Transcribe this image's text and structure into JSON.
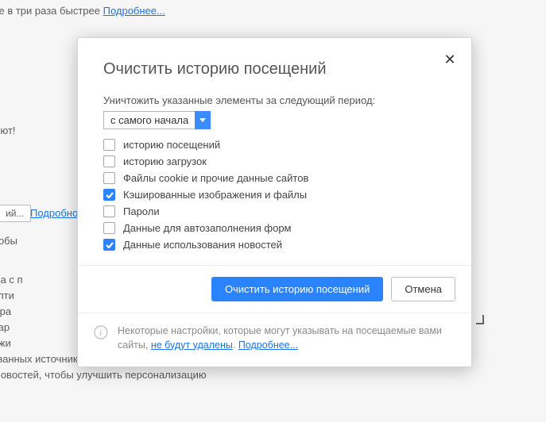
{
  "bg": {
    "top_text": "ботать в интернете в три раза быстрее",
    "top_link": "Подробнее...",
    "mid1": "та криптовалют!",
    "btn_suffix": "ий...",
    "link2": "Подробно",
    "mid2": "б-службы, чтобы",
    "p1": "росы и адреса с п",
    "p2": "йствия для опти",
    "p3": "ть Opera, отпра",
    "p4": "отчеты об авар",
    "p5": "ок «Не отслежи",
    "p6": "я рекомендованных источников в «Новостях» на основании истории посещении",
    "p7": "ользовании новостей, чтобы улучшить персонализацию"
  },
  "dialog": {
    "title": "Очистить историю посещений",
    "period_label": "Уничтожить указанные элементы за следующий период:",
    "period_value": "с самого начала",
    "options": [
      {
        "label": "историю посещений",
        "checked": false
      },
      {
        "label": "историю загрузок",
        "checked": false
      },
      {
        "label": "Файлы cookie и прочие данные сайтов",
        "checked": false
      },
      {
        "label": "Кэшированные изображения и файлы",
        "checked": true
      },
      {
        "label": "Пароли",
        "checked": false
      },
      {
        "label": "Данные для автозаполнения форм",
        "checked": false
      },
      {
        "label": "Данные использования новостей",
        "checked": true
      }
    ],
    "primary_btn": "Очистить историю посещений",
    "secondary_btn": "Отмена",
    "note_text_a": "Некоторые настройки, которые могут указывать на посещаемые вами сайты, ",
    "note_link1": "не будут удалены",
    "note_sep": ". ",
    "note_link2": "Подробнее..."
  }
}
